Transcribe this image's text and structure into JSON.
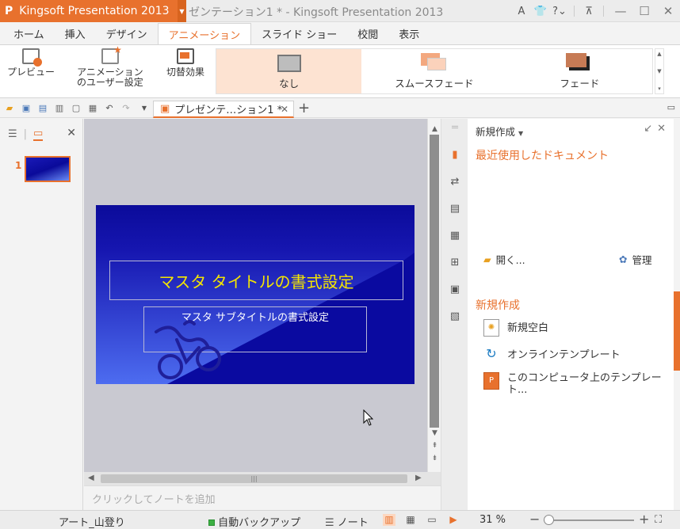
{
  "app": {
    "logo": "P",
    "name": "Kingsoft Presentation 2013",
    "window_title": "ゼンテーション1 * - Kingsoft Presentation 2013"
  },
  "titlebar_icons": [
    "A",
    "👕",
    "?",
    "⌄",
    "⊼",
    "—",
    "☐",
    "✕"
  ],
  "tabs": [
    {
      "label": "ホーム",
      "active": false
    },
    {
      "label": "挿入",
      "active": false
    },
    {
      "label": "デザイン",
      "active": false
    },
    {
      "label": "アニメーション",
      "active": true
    },
    {
      "label": "スライド ショー",
      "active": false
    },
    {
      "label": "校閲",
      "active": false
    },
    {
      "label": "表示",
      "active": false
    }
  ],
  "ribbon": {
    "preview": "プレビュー",
    "custom_anim_line1": "アニメーション",
    "custom_anim_line2": "のユーザー設定",
    "switch_effect": "切替効果",
    "gallery": [
      "なし",
      "スムースフェード",
      "フェード"
    ]
  },
  "document_tab": {
    "label": "プレゼンテ…ション1 *"
  },
  "slide_panel": {
    "thumb_number": "1"
  },
  "slide": {
    "title": "マスタ タイトルの書式設定",
    "subtitle": "マスタ サブタイトルの書式設定"
  },
  "notes": {
    "placeholder": "クリックしてノートを追加"
  },
  "taskpane": {
    "header": "新規作成",
    "recent_heading": "最近使用したドキュメント",
    "open_link": "開く...",
    "manage_link": "管理",
    "new_heading": "新規作成",
    "items": [
      {
        "label": "新規空白"
      },
      {
        "label": "オンラインテンプレート"
      },
      {
        "label": "このコンピュータ上のテンプレート..."
      }
    ]
  },
  "status": {
    "theme": "アート_山登り",
    "backup": "自動バックアップ",
    "notes": "ノート",
    "zoom": "31 %"
  },
  "colors": {
    "accent": "#e8712d",
    "slide_title": "#f5e600"
  }
}
